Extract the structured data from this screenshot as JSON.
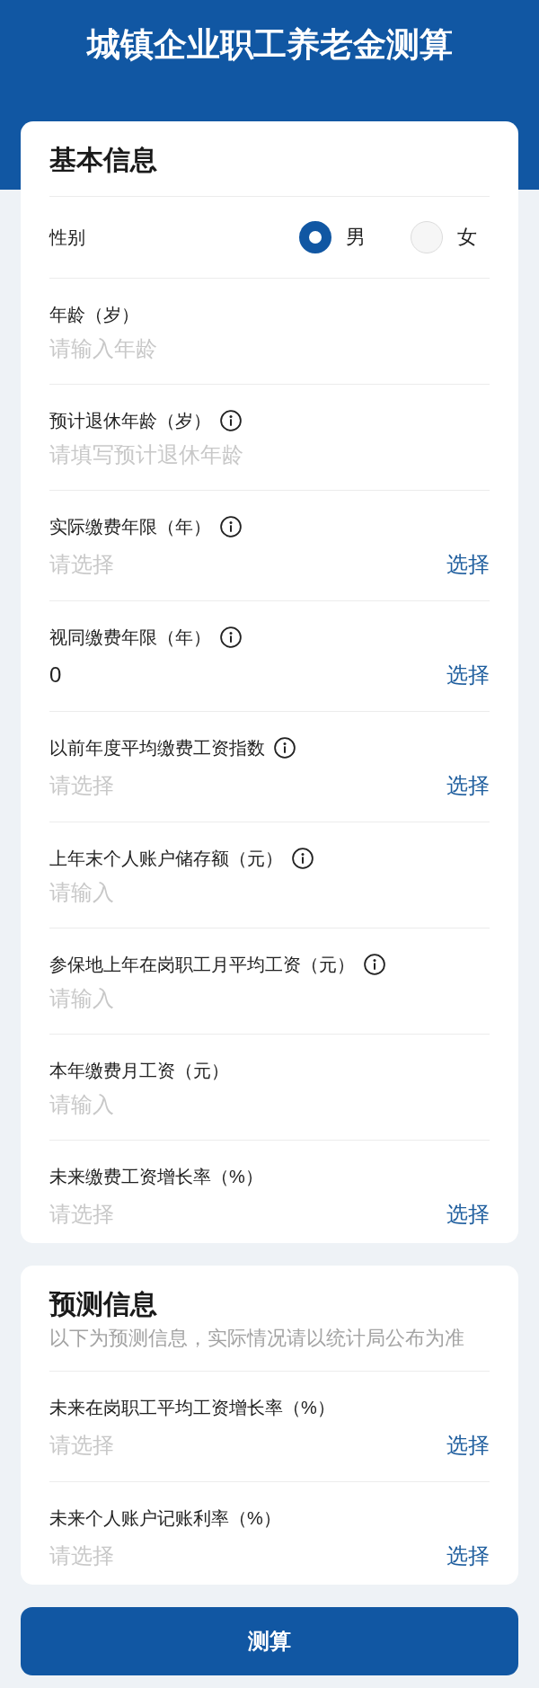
{
  "header": {
    "title": "城镇企业职工养老金测算"
  },
  "sections": [
    {
      "title": "基本信息",
      "fields": [
        {
          "kind": "radio",
          "label": "性别",
          "options": [
            {
              "label": "男",
              "selected": true
            },
            {
              "label": "女",
              "selected": false
            }
          ]
        },
        {
          "kind": "input",
          "label": "年龄（岁）",
          "info": false,
          "placeholder": "请输入年龄"
        },
        {
          "kind": "input",
          "label": "预计退休年龄（岁）",
          "info": true,
          "placeholder": "请填写预计退休年龄"
        },
        {
          "kind": "select",
          "label": "实际缴费年限（年）",
          "info": true,
          "placeholder": "请选择",
          "action": "选择"
        },
        {
          "kind": "select",
          "label": "视同缴费年限（年）",
          "info": true,
          "value": "0",
          "action": "选择"
        },
        {
          "kind": "select",
          "label": "以前年度平均缴费工资指数",
          "info": true,
          "placeholder": "请选择",
          "action": "选择"
        },
        {
          "kind": "input",
          "label": "上年末个人账户储存额（元）",
          "info": true,
          "placeholder": "请输入"
        },
        {
          "kind": "input",
          "label": "参保地上年在岗职工月平均工资（元）",
          "info": true,
          "placeholder": "请输入"
        },
        {
          "kind": "input",
          "label": "本年缴费月工资（元）",
          "info": false,
          "placeholder": "请输入"
        },
        {
          "kind": "select",
          "label": "未来缴费工资增长率（%）",
          "info": false,
          "placeholder": "请选择",
          "action": "选择"
        }
      ]
    },
    {
      "title": "预测信息",
      "subtitle": "以下为预测信息，实际情况请以统计局公布为准",
      "fields": [
        {
          "kind": "select",
          "label": "未来在岗职工平均工资增长率（%）",
          "info": false,
          "placeholder": "请选择",
          "action": "选择"
        },
        {
          "kind": "select",
          "label": "未来个人账户记账利率（%）",
          "info": false,
          "placeholder": "请选择",
          "action": "选择"
        }
      ]
    }
  ],
  "submit_button": {
    "label": "测算"
  }
}
